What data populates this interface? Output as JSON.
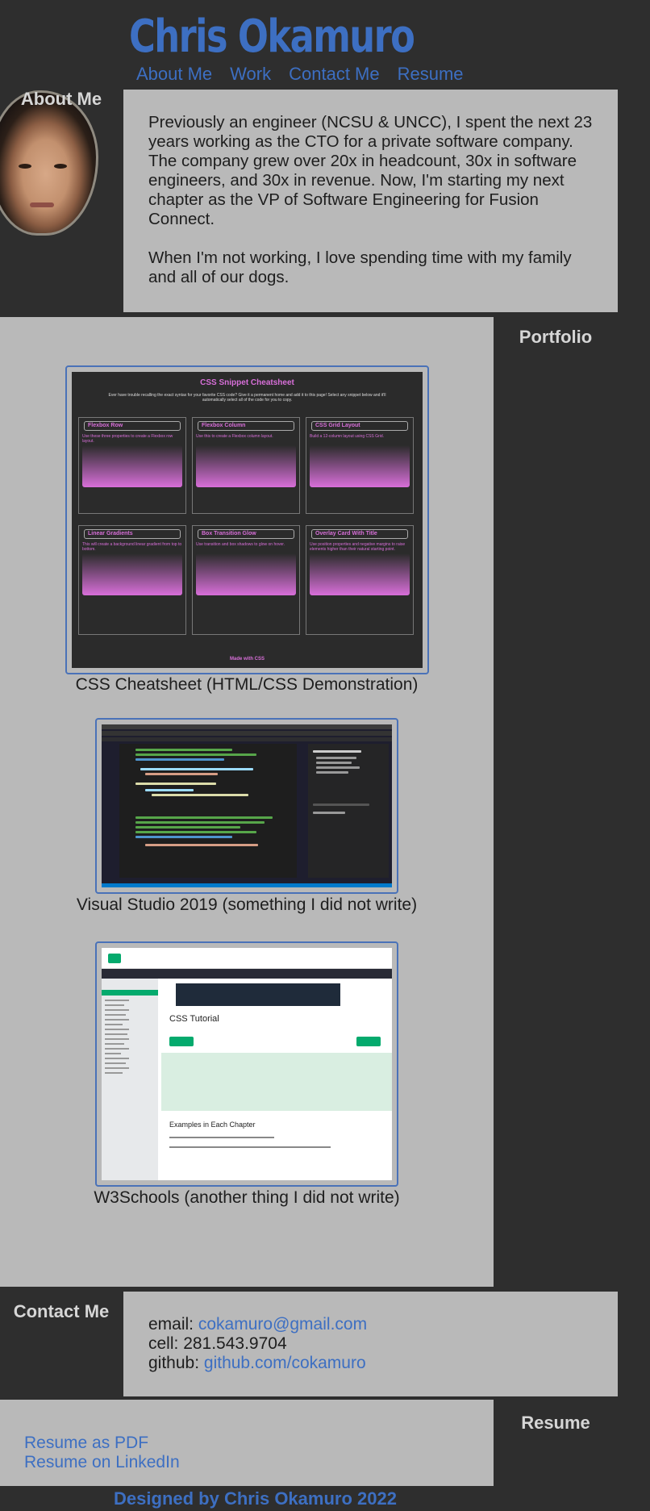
{
  "header": {
    "title": "Chris Okamuro",
    "nav": [
      "About Me",
      "Work",
      "Contact Me",
      "Resume"
    ]
  },
  "about": {
    "label": "About Me",
    "paragraphs": [
      "Previously an engineer (NCSU & UNCC), I spent the next 23 years working as the CTO for a private software company. The company grew over 20x in headcount, 30x in software engineers, and 30x in revenue. Now, I'm starting my next chapter as the VP of Software Engineering for Fusion Connect.",
      "When I'm not working, I love spending time with my family and all of our dogs."
    ]
  },
  "portfolio": {
    "label": "Portfolio",
    "items": [
      {
        "caption": "CSS Cheatsheet (HTML/CSS Demonstration)",
        "thumb": {
          "title": "CSS Snippet Cheatsheet",
          "subtitle": "Ever have trouble recalling the exact syntax for your favorite CSS code? Give it a permanent home and add it to this page! Select any snippet below and it'll automatically select all of the code for you to copy.",
          "cards": [
            {
              "title": "Flexbox Row",
              "desc": "Use these three properties to create a Flexbox row layout."
            },
            {
              "title": "Flexbox Column",
              "desc": "Use this to create a Flexbox column layout."
            },
            {
              "title": "CSS Grid Layout",
              "desc": "Build a 12-column layout using CSS Grid."
            },
            {
              "title": "Linear Gradients",
              "desc": "This will create a background linear gradient from top to bottom."
            },
            {
              "title": "Box Transition Glow",
              "desc": "Use transition and box shadows to glow on hover."
            },
            {
              "title": "Overlay Card With Title",
              "desc": "Use position properties and negative margins to raise elements higher than their natural starting point."
            }
          ],
          "footer": "Made with CSS"
        }
      },
      {
        "caption": "Visual Studio 2019 (something I did not write)"
      },
      {
        "caption": "W3Schools (another thing I did not write)",
        "thumb": {
          "heading": "CSS Tutorial",
          "subheading": "Examples in Each Chapter"
        }
      }
    ]
  },
  "contact": {
    "label": "Contact Me",
    "email_label": "email:",
    "email": "cokamuro@gmail.com",
    "cell_label": "cell:",
    "cell": "281.543.9704",
    "github_label": "github:",
    "github": "github.com/cokamuro"
  },
  "resume": {
    "label": "Resume",
    "links": [
      "Resume as PDF",
      "Resume on LinkedIn"
    ]
  },
  "footer": "Designed by Chris Okamuro 2022"
}
